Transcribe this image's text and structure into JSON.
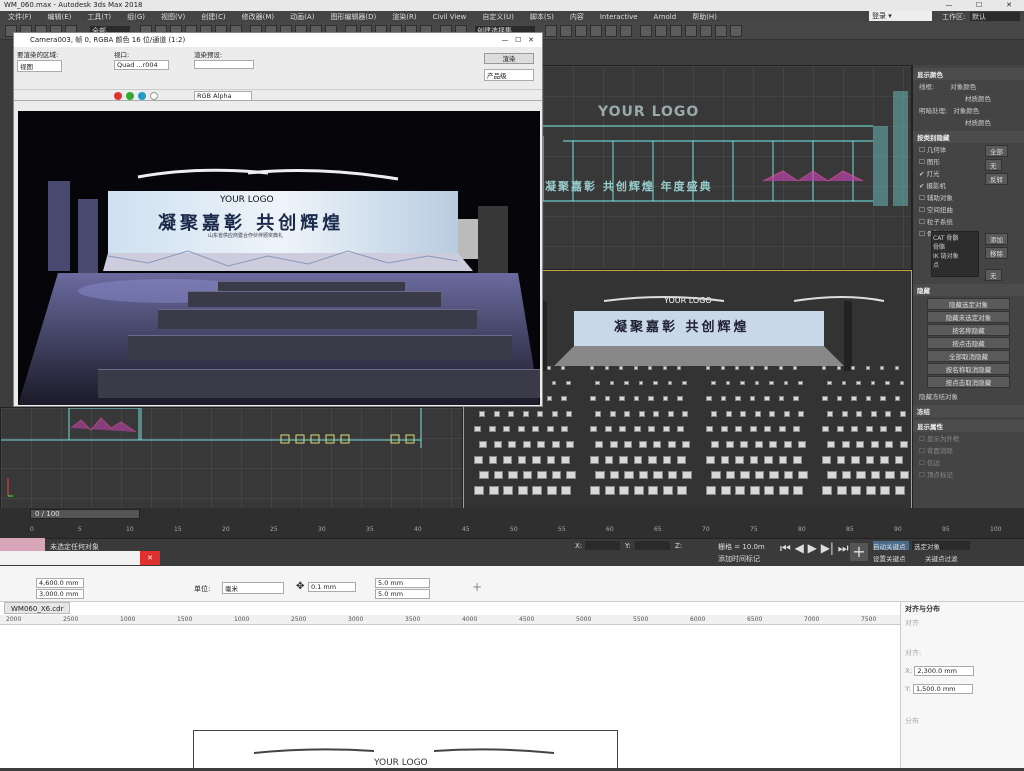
{
  "app": {
    "title": "WM_060.max - Autodesk 3ds Max 2018",
    "login": "登录",
    "workspace_label": "工作区:",
    "workspace_value": "默认"
  },
  "menu": [
    "文件(F)",
    "编辑(E)",
    "工具(T)",
    "组(G)",
    "视图(V)",
    "创建(C)",
    "修改器(M)",
    "动画(A)",
    "图形编辑器(D)",
    "渲染(R)",
    "Civil View",
    "自定义(U)",
    "脚本(S)",
    "内容",
    "Interactive",
    "Arnold",
    "帮助(H)"
  ],
  "toolbar": {
    "select_filter": "全部",
    "selection_set": "创建选择集"
  },
  "render_window": {
    "title": "Camera003, 帧 0, RGBA 颜色 16 位/通道 (1:2)",
    "area_label": "要渲染的区域:",
    "area_value": "视图",
    "viewport_label": "视口:",
    "viewport_value": "Quad ...r004",
    "preset_label": "渲染预设:",
    "preset_value": "",
    "render_btn": "渲染",
    "product_value": "产品级",
    "channel_value": "RGB Alpha"
  },
  "stage": {
    "logo": "YOUR LOGO",
    "headline": "凝聚嘉彰 共创辉煌",
    "subline": "山东省供应商暨合作伙伴颁奖典礼"
  },
  "front_view": {
    "logo": "YOUR LOGO",
    "banner": "凝聚嘉彰 共创辉煌 年度盛典"
  },
  "perspective": {
    "logo": "YOUR LOGO",
    "headline": "凝聚嘉彰 共创辉煌"
  },
  "cmd_panel": {
    "sec_display_color": "显示颜色",
    "wireframe": "线框:",
    "obj_color": "对象颜色",
    "mat_color": "材质颜色",
    "shaded": "明暗处理:",
    "obj_color2": "对象颜色",
    "mat_color2": "材质颜色",
    "sec_hide_by_cat": "按类别隐藏",
    "cats": [
      "几何体",
      "图形",
      "灯光",
      "摄影机",
      "辅助对象",
      "空间扭曲",
      "粒子系统",
      "骨骼对象"
    ],
    "btn_all": "全部",
    "btn_none": "无",
    "btn_invert": "反转",
    "list_items": [
      "CAT 骨骼",
      "骨骼",
      "IK 链对象",
      "点"
    ],
    "btn_add": "添加",
    "btn_remove": "移除",
    "btn_none2": "无",
    "sec_hide": "隐藏",
    "hide_btns": [
      "隐藏选定对象",
      "隐藏未选定对象",
      "按名称隐藏",
      "按点击隐藏",
      "全部取消隐藏",
      "按名称取消隐藏",
      "按点击取消隐藏"
    ],
    "hide_frozen": "隐藏冻结对象",
    "sec_freeze": "冻结",
    "sec_display_props": "显示属性",
    "props": [
      "显示为外框",
      "背面消隐",
      "仅边",
      "顶点标记"
    ]
  },
  "timeline": {
    "frame": "0 / 100",
    "ticks": [
      "0",
      "5",
      "10",
      "15",
      "20",
      "25",
      "30",
      "35",
      "40",
      "45",
      "50",
      "55",
      "60",
      "65",
      "70",
      "75",
      "80",
      "85",
      "90",
      "95",
      "100"
    ]
  },
  "status": {
    "message": "未选定任何对象",
    "x_label": "X:",
    "y_label": "Y:",
    "z_label": "Z:",
    "grid": "栅格 = 10.0m",
    "add_time_tag": "添加时间标记",
    "auto_key": "自动关键点",
    "set_key": "设置关键点",
    "selected": "选定对象",
    "key_filter": "关键点过滤器..."
  },
  "cdr": {
    "w": "4,600.0 mm",
    "h": "3,000.0 mm",
    "unit_label": "单位:",
    "unit_value": "毫米",
    "nudge": "0.1 mm",
    "dup_x": "5.0 mm",
    "dup_y": "5.0 mm",
    "tab": "WM060_X6.cdr",
    "ruler": [
      "2000",
      "2500",
      "1000",
      "1500",
      "1000",
      "2500",
      "3000",
      "3500",
      "4000",
      "4500",
      "5000",
      "5500",
      "6000",
      "6500",
      "7000",
      "7500"
    ],
    "dock_title": "对齐与分布",
    "dock_align": "对齐",
    "dock_align2": "对齐:",
    "dock_x": "2,300.0 mm",
    "dock_y": "1,500.0 mm",
    "dock_dist": "分布",
    "logo": "YOUR LOGO"
  }
}
